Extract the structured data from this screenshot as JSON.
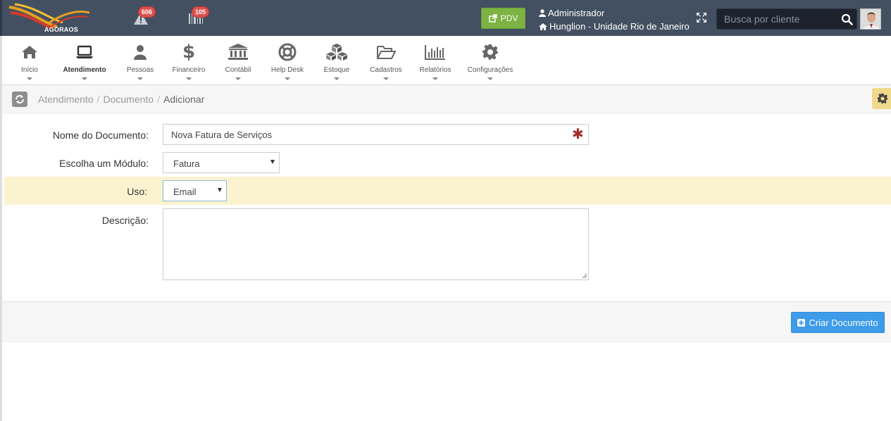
{
  "topbar": {
    "logo_text": "AGORAOS",
    "notifications": [
      {
        "name": "alerts",
        "count": "606"
      },
      {
        "name": "barcode",
        "count": "105"
      }
    ],
    "pdv_label": "PDV",
    "user_name": "Administrador",
    "unit_name": "Hunglion - Unidade Rio de Janeiro",
    "search_placeholder": "Busca por cliente"
  },
  "nav": {
    "items": [
      {
        "label": "Início",
        "icon": "home-icon"
      },
      {
        "label": "Atendimento",
        "icon": "laptop-icon"
      },
      {
        "label": "Pessoas",
        "icon": "user-icon"
      },
      {
        "label": "Financeiro",
        "icon": "dollar-icon"
      },
      {
        "label": "Contábil",
        "icon": "bank-icon"
      },
      {
        "label": "Help Desk",
        "icon": "lifebuoy-icon"
      },
      {
        "label": "Estoque",
        "icon": "cubes-icon"
      },
      {
        "label": "Cadastros",
        "icon": "folder-open-icon"
      },
      {
        "label": "Relatórios",
        "icon": "bar-chart-icon"
      },
      {
        "label": "Configurações",
        "icon": "gear-icon"
      }
    ],
    "active": "Atendimento"
  },
  "breadcrumb": {
    "items": [
      "Atendimento",
      "Documento"
    ],
    "current": "Adicionar"
  },
  "form": {
    "nome_label": "Nome do Documento:",
    "nome_value": "Nova Fatura de Serviços",
    "modulo_label": "Escolha um Módulo:",
    "modulo_value": "Fatura",
    "uso_label": "Uso:",
    "uso_value": "Email",
    "descricao_label": "Descrição:",
    "descricao_value": ""
  },
  "actions": {
    "create_label": "Criar Documento"
  },
  "colors": {
    "topbar": "#435061",
    "pdv": "#7cb342",
    "primary": "#3d9be9",
    "highlight": "#fbf3cf",
    "badge": "#d9534f"
  }
}
